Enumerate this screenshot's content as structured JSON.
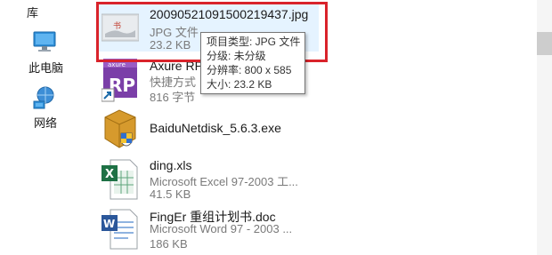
{
  "nav": {
    "library_label": "库",
    "this_pc_label": "此电脑",
    "network_label": "网络"
  },
  "files": [
    {
      "name": "2009052109150021​9437.jpg",
      "type": "JPG 文件",
      "size": "23.2 KB",
      "icon": "jpg-thumbnail"
    },
    {
      "name": "Axure RP",
      "type": "快捷方式",
      "size": "816 字节",
      "icon": "axure-rp-icon"
    },
    {
      "name": "BaiduNetdisk_5.6.3.exe",
      "type": "",
      "size": "",
      "icon": "installer-icon"
    },
    {
      "name": "ding.xls",
      "type": "Microsoft Excel 97-2003 工...",
      "size": "41.5 KB",
      "icon": "excel-icon"
    },
    {
      "name": "FingEr 重组计划书.doc",
      "type": "Microsoft Word 97 - 2003 ...",
      "size": "186 KB",
      "icon": "word-icon"
    }
  ],
  "tooltip": {
    "line1": "项目类型: JPG 文件",
    "line2": "分级: 未分级",
    "line3": "分辨率: 800 x 585",
    "line4": "大小: 23.2 KB"
  },
  "colors": {
    "highlight": "#d9232b",
    "selection": "#e5f3ff"
  }
}
